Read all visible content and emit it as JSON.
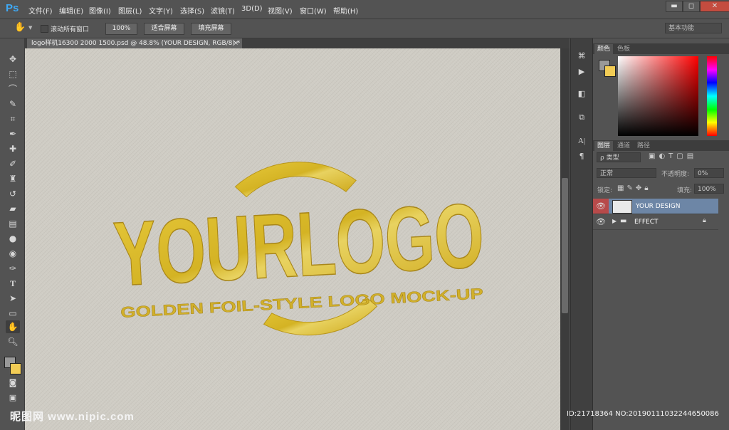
{
  "app": {
    "logo": "Ps"
  },
  "menu": [
    "文件(F)",
    "编辑(E)",
    "图像(I)",
    "图层(L)",
    "文字(Y)",
    "选择(S)",
    "滤镜(T)",
    "3D(D)",
    "视图(V)",
    "窗口(W)",
    "帮助(H)"
  ],
  "window_controls": {
    "minimize": "▬",
    "restore": "◻",
    "close": "✕"
  },
  "options_bar": {
    "scroll_all_label": "滚动所有窗口",
    "zoom_100": "100%",
    "fit_screen": "适合屏幕",
    "fill_screen": "填充屏幕",
    "workspace": "基本功能"
  },
  "document": {
    "tab_label": "logo样机16300 2000 1500.psd @ 48.8% (YOUR DESIGN, RGB/8) *",
    "tab_close": "×",
    "logo_text": "YOURLOGO",
    "tagline": "GOLDEN FOIL-STYLE LOGO MOCK-UP",
    "foil_color": "#d9bb2a",
    "paper_color": "#cfccc4"
  },
  "color_panel": {
    "tabs": [
      "颜色",
      "色板"
    ]
  },
  "layers_panel": {
    "tabs": [
      "图层",
      "通道",
      "路径"
    ],
    "filter_kind": "ρ 类型",
    "blend_mode": "正常",
    "opacity_label": "不透明度:",
    "opacity_value": "0%",
    "lock_label": "锁定:",
    "fill_label": "填充:",
    "fill_value": "100%",
    "layers": [
      {
        "name": "YOUR DESIGN"
      },
      {
        "name": "EFFECT"
      }
    ]
  },
  "watermark": {
    "left": "昵图网 www.nipic.com",
    "right": "ID:21718364 NO:20190111032244650086"
  },
  "icons": [
    "hand-icon",
    "move-icon",
    "marquee-icon",
    "lasso-icon",
    "quick-select-icon",
    "crop-icon",
    "eyedropper-icon",
    "healing-icon",
    "brush-icon",
    "stamp-icon",
    "history-brush-icon",
    "eraser-icon",
    "gradient-icon",
    "blur-icon",
    "dodge-icon",
    "pen-icon",
    "type-icon",
    "path-select-icon",
    "rectangle-icon",
    "zoom-icon",
    "eye-icon",
    "folder-icon",
    "lock-icon"
  ]
}
